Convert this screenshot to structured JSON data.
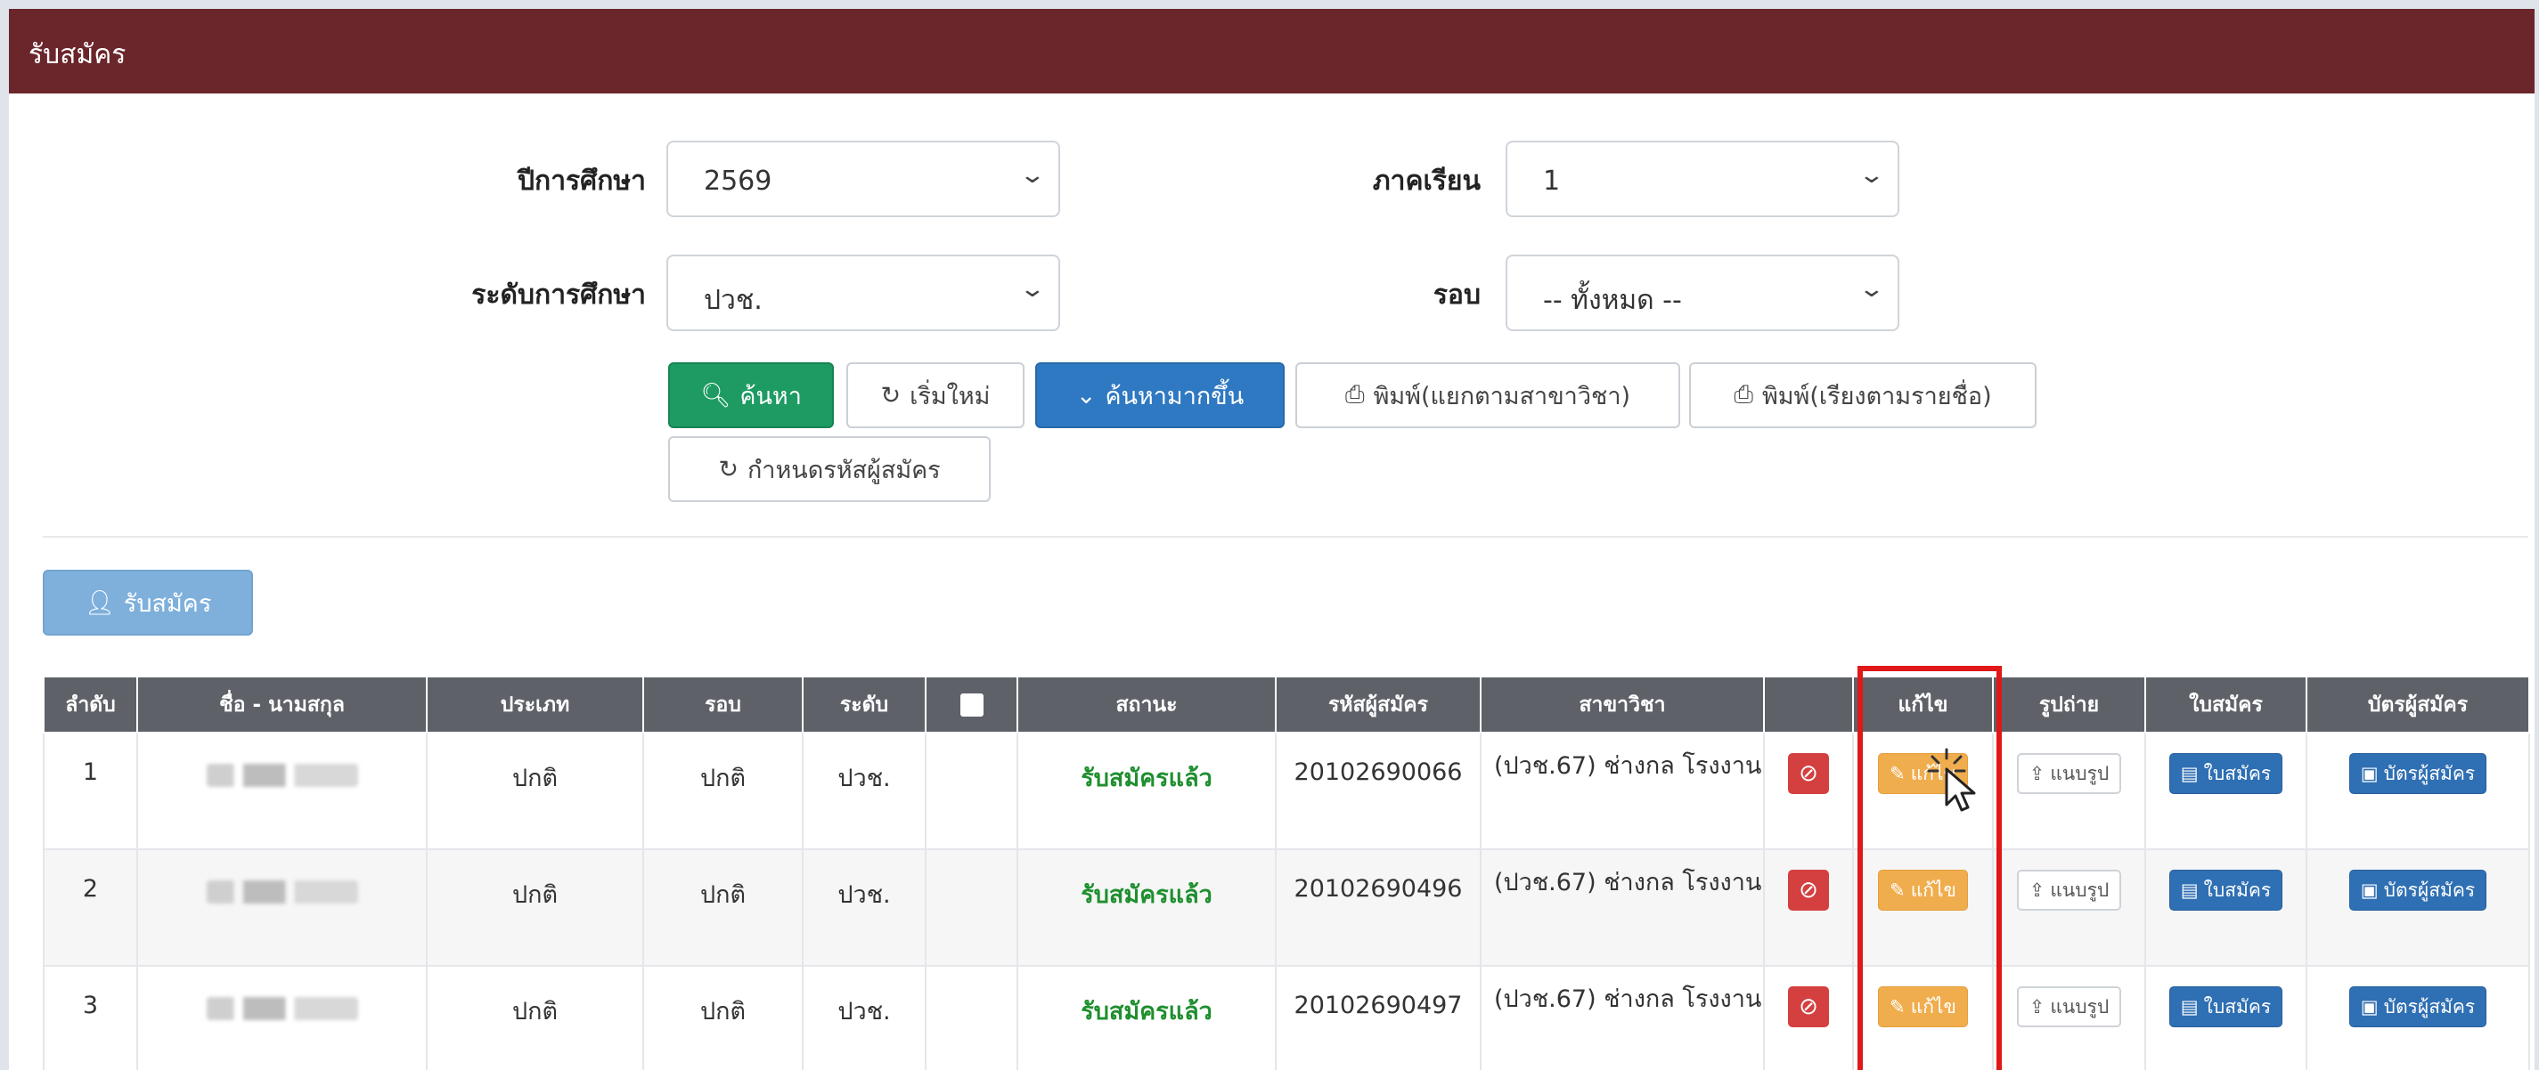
{
  "header": {
    "title": "รับสมัคร"
  },
  "filters": {
    "year_label": "ปีการศึกษา",
    "year_value": "2569",
    "term_label": "ภาคเรียน",
    "term_value": "1",
    "level_label": "ระดับการศึกษา",
    "level_value": "ปวช.",
    "round_label": "รอบ",
    "round_value": "-- ทั้งหมด --"
  },
  "actions": {
    "search": "ค้นหา",
    "reset": "เริ่มใหม่",
    "advanced": "ค้นหามากขึ้น",
    "print_by_major": "พิมพ์(แยกตามสาขาวิชา)",
    "print_by_name": "พิมพ์(เรียงตามรายชื่อ)",
    "assign_code": "กำหนดรหัสผู้สมัคร",
    "apply": "รับสมัคร"
  },
  "table": {
    "headers": {
      "no": "ลำดับ",
      "name": "ชื่อ - นามสกุล",
      "type": "ประเภท",
      "round": "รอบ",
      "level": "ระดับ",
      "status": "สถานะ",
      "code": "รหัสผู้สมัคร",
      "major": "สาขาวิชา",
      "edit": "แก้ไข",
      "photo": "รูปถ่าย",
      "form": "ใบสมัคร",
      "card": "บัตรผู้สมัคร"
    },
    "rows": [
      {
        "no": "1",
        "type": "ปกติ",
        "round": "ปกติ",
        "level": "ปวช.",
        "status": "รับสมัครแล้ว",
        "code": "20102690066",
        "major": "(ปวช.67) ช่างกล โรงงาน"
      },
      {
        "no": "2",
        "type": "ปกติ",
        "round": "ปกติ",
        "level": "ปวช.",
        "status": "รับสมัครแล้ว",
        "code": "20102690496",
        "major": "(ปวช.67) ช่างกล โรงงาน"
      },
      {
        "no": "3",
        "type": "ปกติ",
        "round": "ปกติ",
        "level": "ปวช.",
        "status": "รับสมัครแล้ว",
        "code": "20102690497",
        "major": "(ปวช.67) ช่างกล โรงงาน"
      }
    ],
    "row_buttons": {
      "edit": "แก้ไข",
      "attach_photo": "แนบรูป",
      "form": "ใบสมัคร",
      "card": "บัตรผู้สมัคร"
    }
  },
  "colors": {
    "header_bg": "#6b262b",
    "search_green": "#1d9b62",
    "primary_blue": "#2f78c2",
    "edit_orange": "#f0ad4e",
    "cancel_red": "#d43f3f",
    "status_green": "#1e8f2e",
    "highlight_red": "#e01818"
  }
}
